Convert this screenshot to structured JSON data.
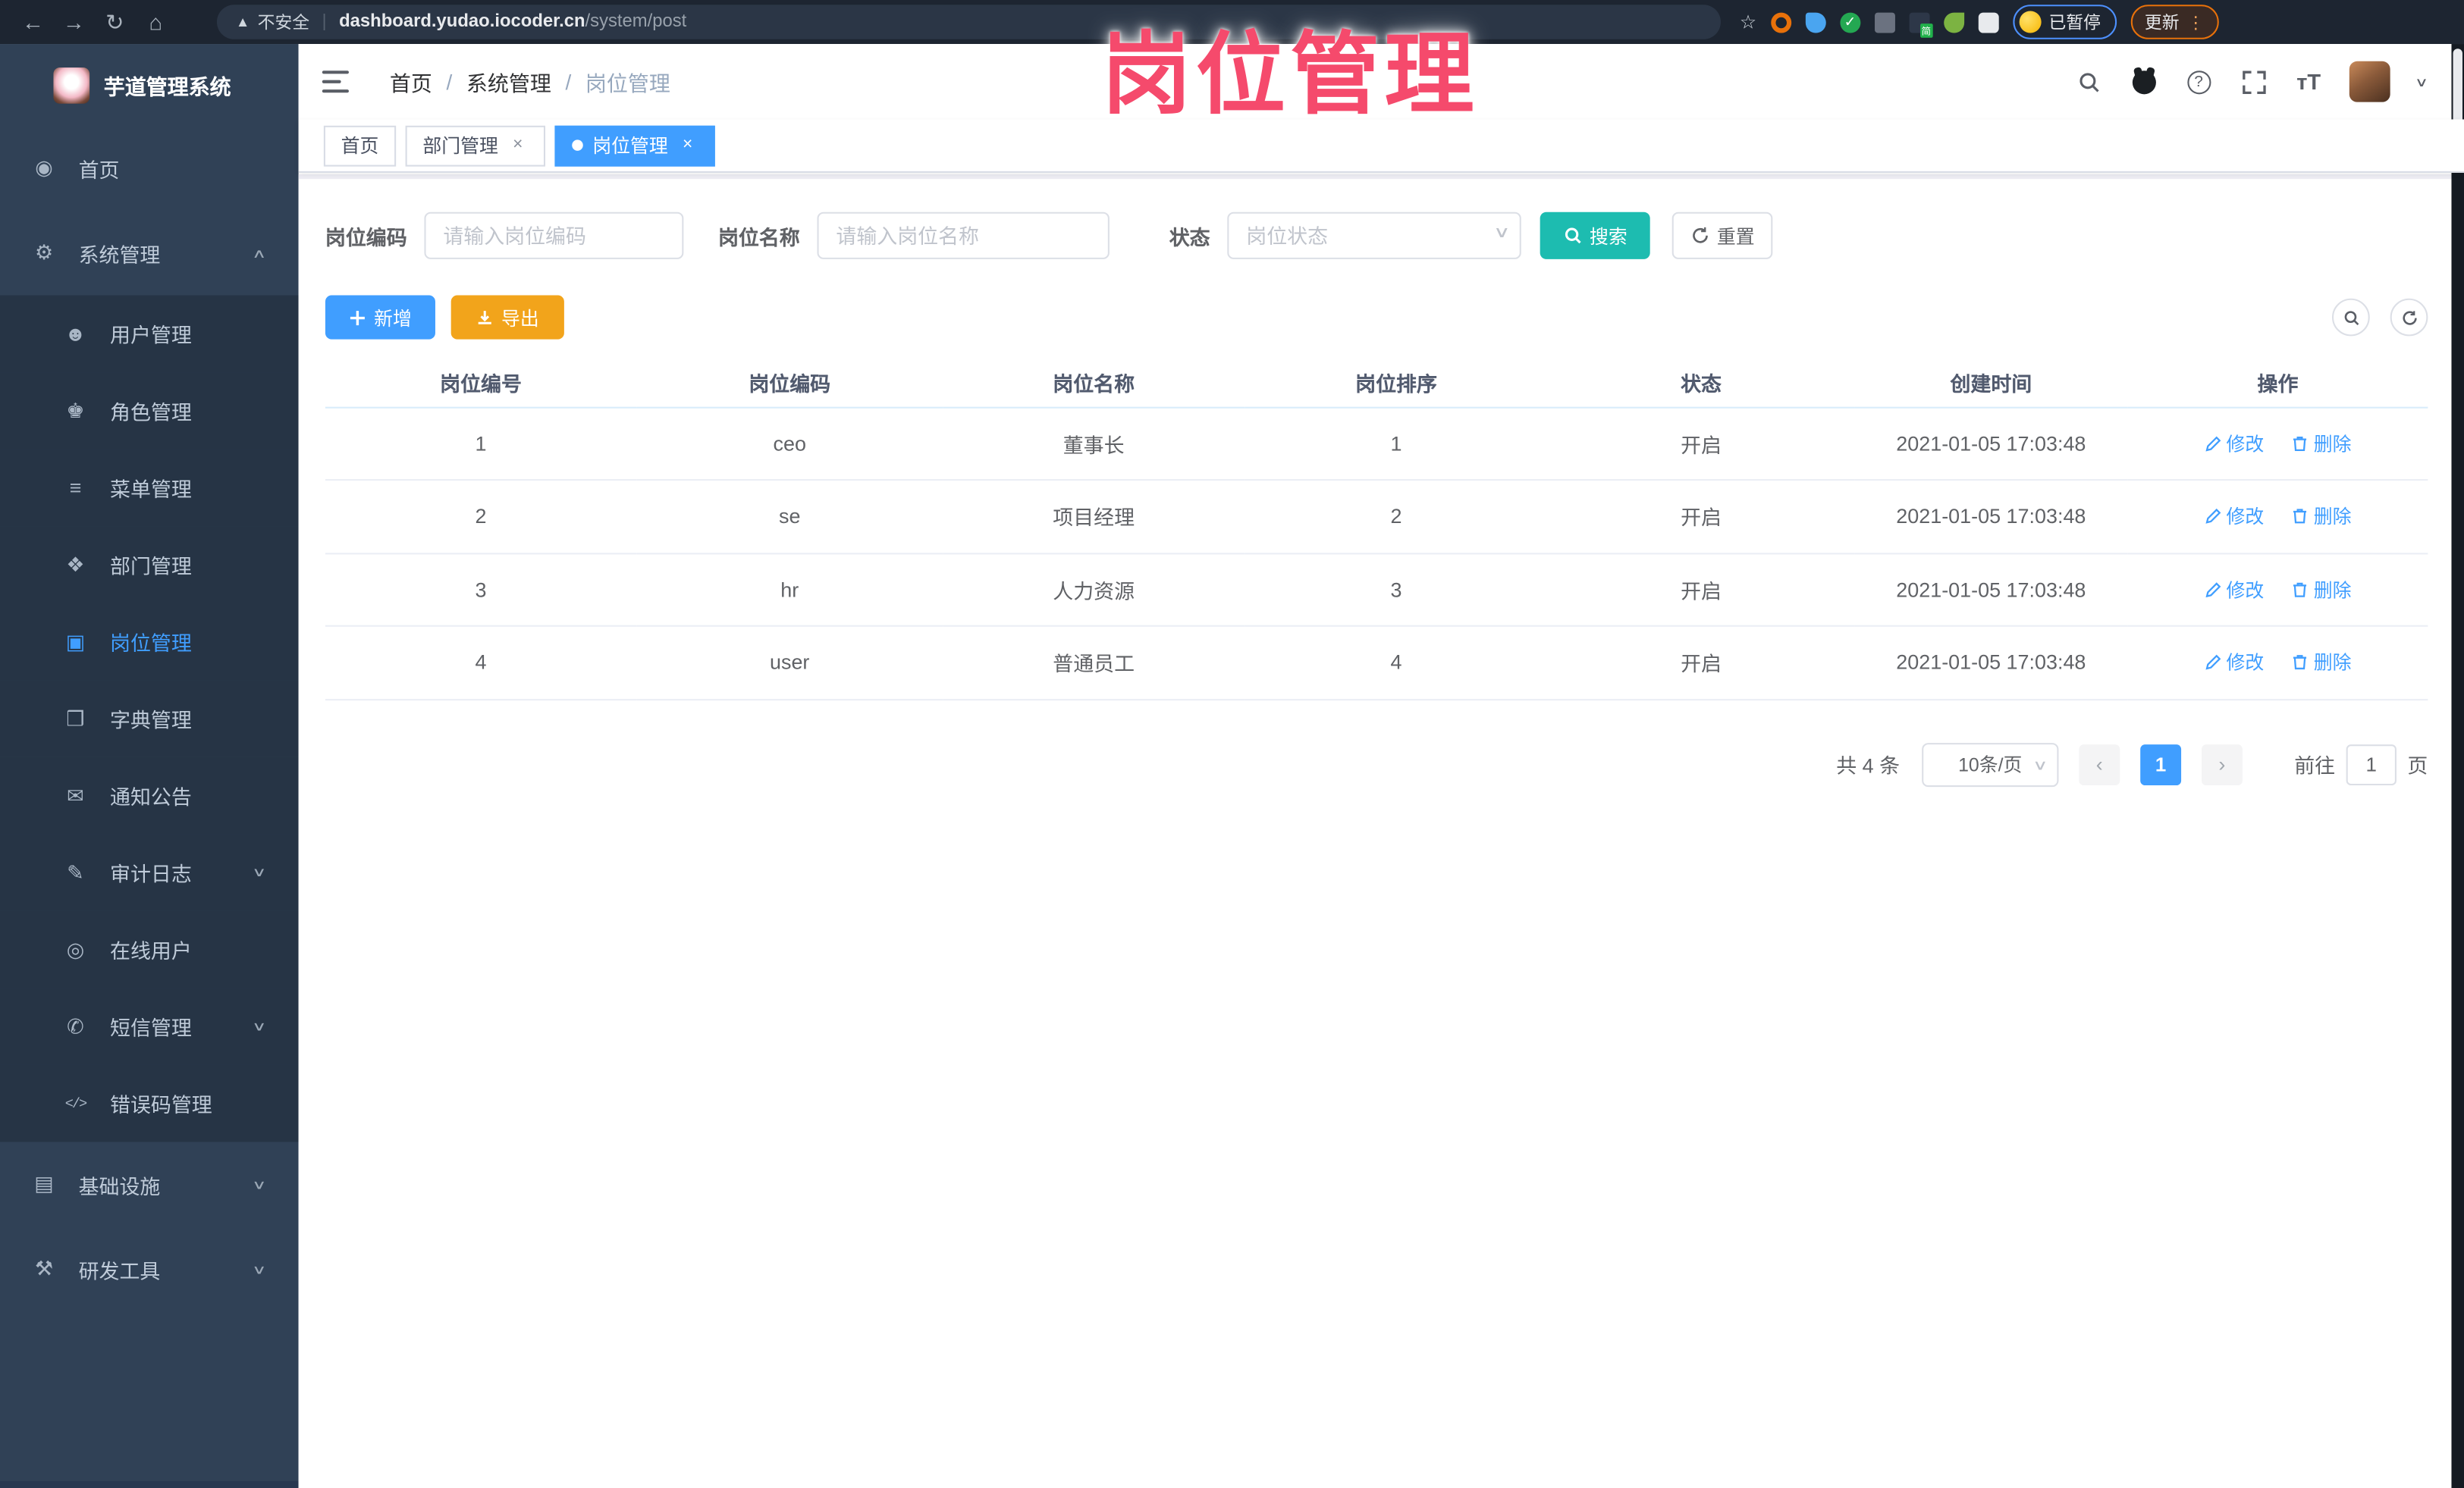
{
  "browser": {
    "security_label": "不安全",
    "url_domain": "dashboard.yudao.iocoder.cn",
    "url_path": "/system/post",
    "extension_badge": "简",
    "paused_label": "已暂停",
    "update_label": "更新"
  },
  "overlay": {
    "title": "岗位管理",
    "color": "#f54a6c"
  },
  "sidebar": {
    "app_title": "芋道管理系统",
    "items": [
      {
        "label": "首页",
        "glyph": "◉"
      },
      {
        "label": "系统管理",
        "glyph": "⚙",
        "caret": "∧"
      },
      {
        "label": "用户管理",
        "glyph": "☻"
      },
      {
        "label": "角色管理",
        "glyph": "♚"
      },
      {
        "label": "菜单管理",
        "glyph": "≡"
      },
      {
        "label": "部门管理",
        "glyph": "❖"
      },
      {
        "label": "岗位管理",
        "glyph": "▣"
      },
      {
        "label": "字典管理",
        "glyph": "❒"
      },
      {
        "label": "通知公告",
        "glyph": "✉"
      },
      {
        "label": "审计日志",
        "glyph": "✎",
        "caret": "∨"
      },
      {
        "label": "在线用户",
        "glyph": "◎"
      },
      {
        "label": "短信管理",
        "glyph": "✆",
        "caret": "∨"
      },
      {
        "label": "错误码管理",
        "glyph": "</>"
      },
      {
        "label": "基础设施",
        "glyph": "▤",
        "caret": "∨"
      },
      {
        "label": "研发工具",
        "glyph": "⚒",
        "caret": "∨"
      }
    ]
  },
  "header": {
    "breadcrumb": [
      "首页",
      "系统管理",
      "岗位管理"
    ],
    "separator": "/",
    "font_size_icon": "тT"
  },
  "tabs": [
    {
      "label": "首页"
    },
    {
      "label": "部门管理",
      "close": "×"
    },
    {
      "label": "岗位管理",
      "close": "×"
    }
  ],
  "filters": {
    "code_label": "岗位编码",
    "code_placeholder": "请输入岗位编码",
    "name_label": "岗位名称",
    "name_placeholder": "请输入岗位名称",
    "status_label": "状态",
    "status_placeholder": "岗位状态",
    "search_label": "搜索",
    "reset_label": "重置"
  },
  "toolbar": {
    "add_label": "新增",
    "export_label": "导出"
  },
  "table": {
    "columns": [
      "岗位编号",
      "岗位编码",
      "岗位名称",
      "岗位排序",
      "状态",
      "创建时间",
      "操作"
    ],
    "edit_label": "修改",
    "delete_label": "删除",
    "rows": [
      {
        "id": "1",
        "code": "ceo",
        "name": "董事长",
        "sort": "1",
        "status": "开启",
        "created": "2021-01-05 17:03:48"
      },
      {
        "id": "2",
        "code": "se",
        "name": "项目经理",
        "sort": "2",
        "status": "开启",
        "created": "2021-01-05 17:03:48"
      },
      {
        "id": "3",
        "code": "hr",
        "name": "人力资源",
        "sort": "3",
        "status": "开启",
        "created": "2021-01-05 17:03:48"
      },
      {
        "id": "4",
        "code": "user",
        "name": "普通员工",
        "sort": "4",
        "status": "开启",
        "created": "2021-01-05 17:03:48"
      }
    ]
  },
  "pagination": {
    "total_label": "共 4 条",
    "page_size_label": "10条/页",
    "prev": "‹",
    "page": "1",
    "next": "›",
    "goto_label": "前往",
    "goto_value": "1",
    "unit_label": "页"
  }
}
